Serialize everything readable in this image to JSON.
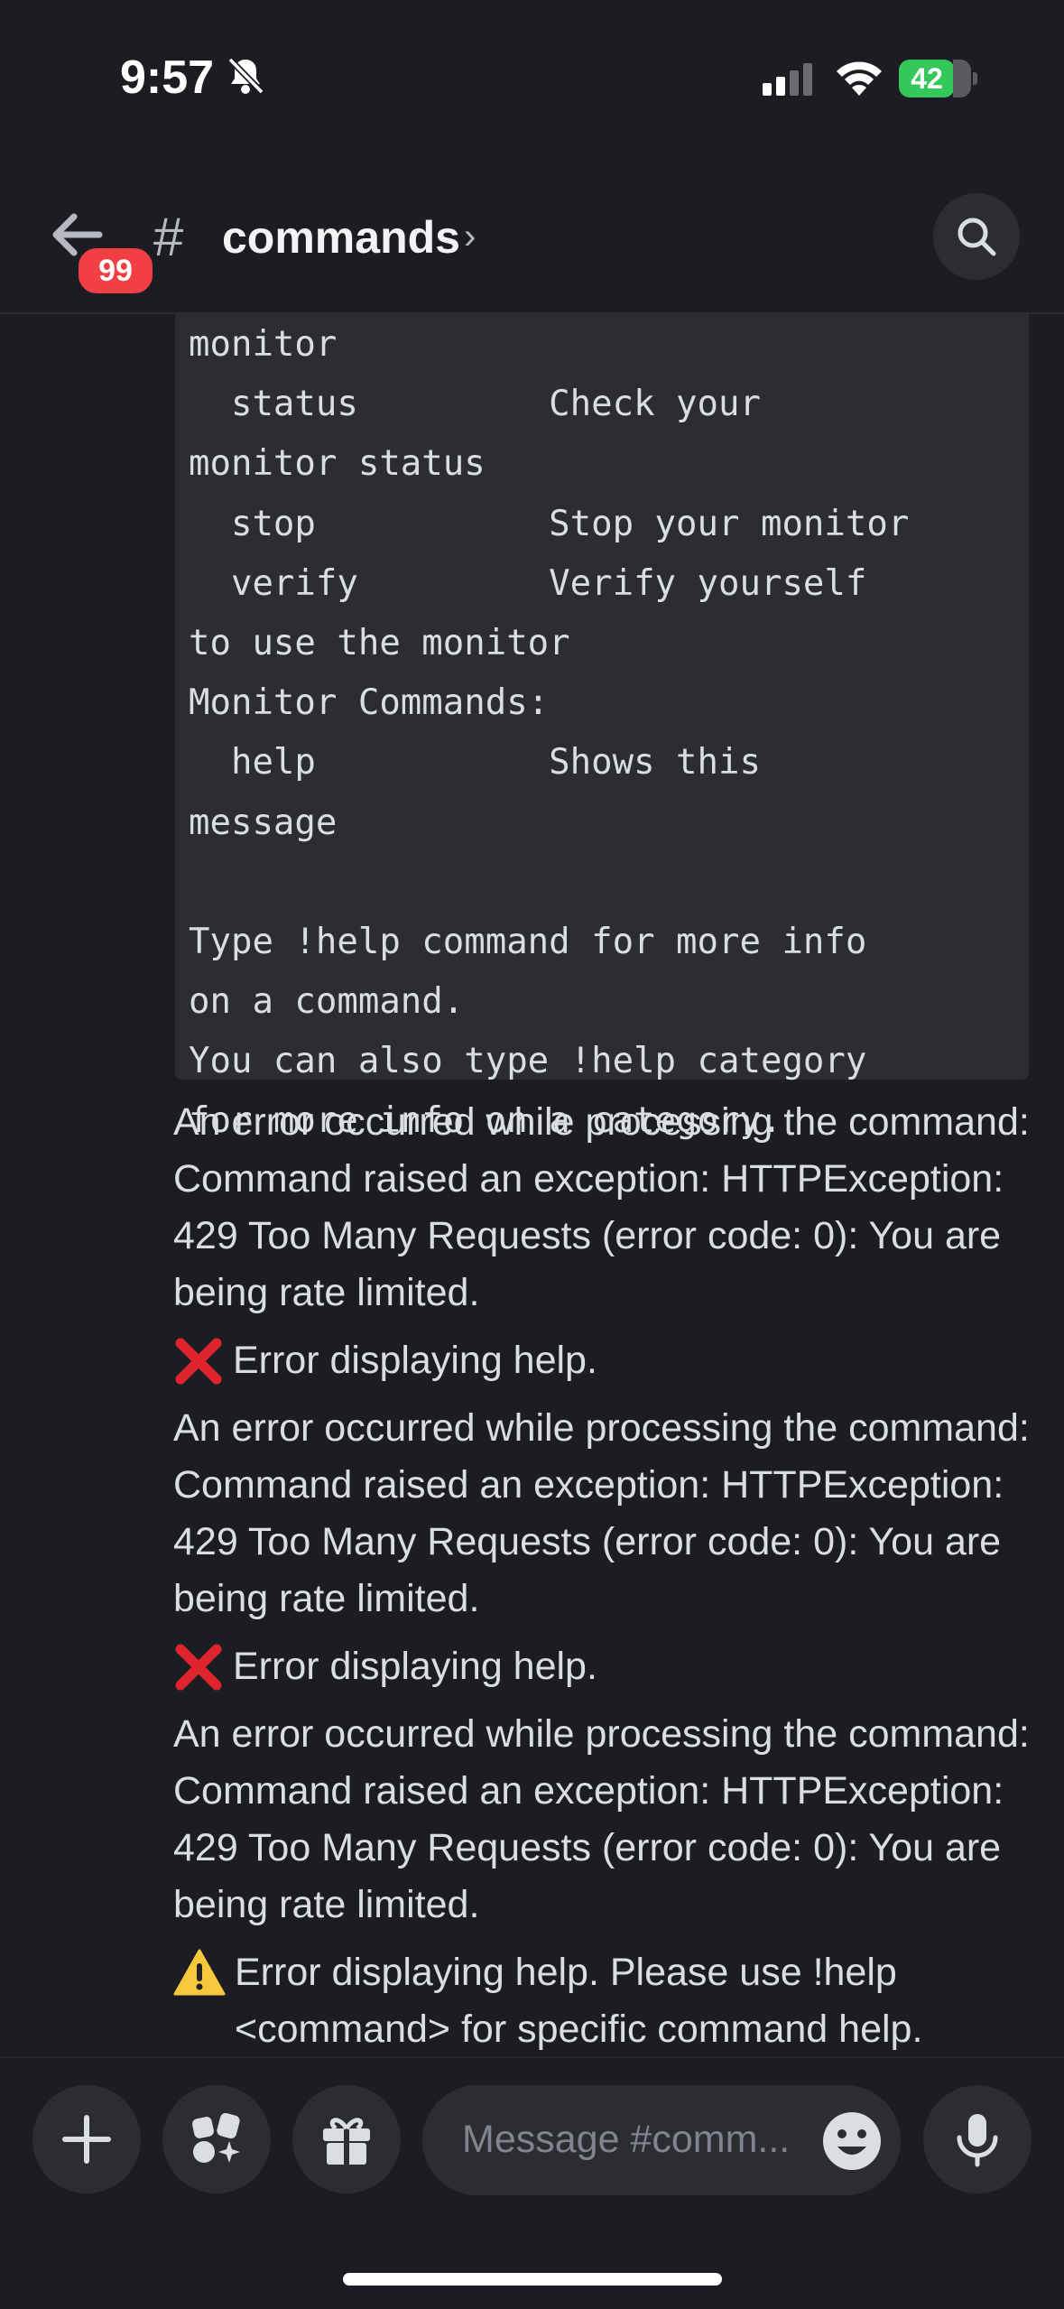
{
  "status_bar": {
    "time": "9:57",
    "battery": "42"
  },
  "header": {
    "unread_badge": "99",
    "channel_hash": "#",
    "channel_name": "commands",
    "chevron": "›"
  },
  "code_block": {
    "lines": [
      "monitor",
      "  status         Check your",
      "monitor status",
      "  stop           Stop your monitor",
      "  verify         Verify yourself",
      "to use the monitor",
      "Monitor Commands:",
      "  help           Shows this",
      "message",
      "",
      "Type !help command for more info",
      "on a command.",
      "You can also type !help category",
      "for more info on a category."
    ]
  },
  "messages": [
    {
      "type": "text",
      "text": "An error occurred while processing the command: Command raised an exception: HTTPException: 429 Too Many Requests (error code: 0): You are being rate limited."
    },
    {
      "type": "error",
      "icon": "cross-mark-icon",
      "text": "Error displaying help."
    },
    {
      "type": "text",
      "text": "An error occurred while processing the command: Command raised an exception: HTTPException: 429 Too Many Requests (error code: 0): You are being rate limited."
    },
    {
      "type": "error",
      "icon": "cross-mark-icon",
      "text": "Error displaying help."
    },
    {
      "type": "text",
      "text": "An error occurred while processing the command: Command raised an exception: HTTPException: 429 Too Many Requests (error code: 0): You are being rate limited."
    },
    {
      "type": "warning",
      "icon": "warning-icon",
      "text": "Error displaying help. Please use !help <command> for specific command help."
    }
  ],
  "composer": {
    "placeholder": "Message #comm..."
  },
  "colors": {
    "background": "#1c1d22",
    "surface": "#2b2d31",
    "badge_red": "#f23f43",
    "battery_green": "#34c759"
  }
}
